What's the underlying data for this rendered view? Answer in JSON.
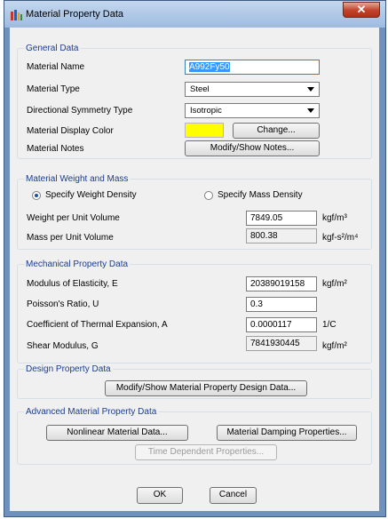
{
  "window": {
    "title": "Material Property Data",
    "close_glyph": "✕"
  },
  "general": {
    "title": "General Data",
    "material_name_label": "Material Name",
    "material_name_value": "A992Fy50",
    "material_type_label": "Material Type",
    "material_type_value": "Steel",
    "symmetry_label": "Directional Symmetry Type",
    "symmetry_value": "Isotropic",
    "display_color_label": "Material Display Color",
    "display_color_value": "#ffff00",
    "change_button": "Change...",
    "notes_label": "Material Notes",
    "notes_button": "Modify/Show Notes..."
  },
  "weight": {
    "title": "Material Weight and Mass",
    "radio_weight": "Specify Weight Density",
    "radio_mass": "Specify Mass Density",
    "selected": "weight",
    "weight_label": "Weight per Unit Volume",
    "weight_value": "7849.05",
    "weight_unit": "kgf/m³",
    "mass_label": "Mass per Unit Volume",
    "mass_value": "800.38",
    "mass_unit": "kgf-s²/m⁴"
  },
  "mechanical": {
    "title": "Mechanical Property Data",
    "modulus_label": "Modulus of Elasticity,  E",
    "modulus_value": "20389019158",
    "modulus_unit": "kgf/m²",
    "poisson_label": "Poisson's Ratio,  U",
    "poisson_value": "0.3",
    "thermal_label": "Coefficient of Thermal Expansion,  A",
    "thermal_value": "0.0000117",
    "thermal_unit": "1/C",
    "shear_label": "Shear Modulus,  G",
    "shear_value": "7841930445",
    "shear_unit": "kgf/m²"
  },
  "design": {
    "title": "Design Property Data",
    "button": "Modify/Show Material Property Design Data..."
  },
  "advanced": {
    "title": "Advanced Material Property Data",
    "nonlinear_button": "Nonlinear Material Data...",
    "damping_button": "Material Damping Properties...",
    "time_button": "Time Dependent Properties..."
  },
  "footer": {
    "ok": "OK",
    "cancel": "Cancel"
  }
}
